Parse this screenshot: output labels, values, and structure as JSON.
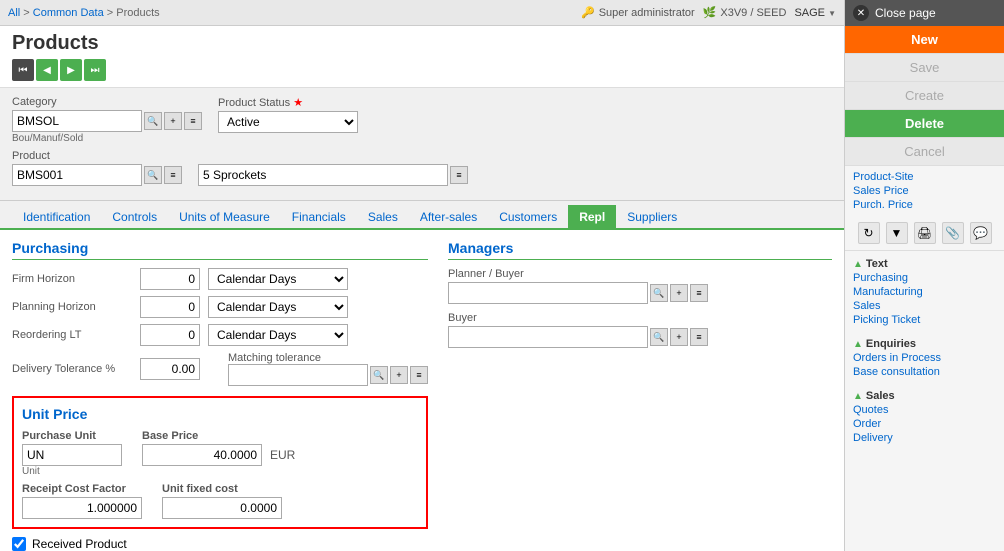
{
  "breadcrumb": {
    "all": "All",
    "common_data": "Common Data",
    "products": "Products"
  },
  "user_info": {
    "admin": "Super administrator",
    "version": "X3V9 / SEED",
    "sage": "SAGE"
  },
  "page": {
    "title": "Products"
  },
  "nav": {
    "first": "⏮",
    "prev": "◀",
    "next": "▶",
    "last": "⏭"
  },
  "form": {
    "category_label": "Category",
    "category_value": "BMSOL",
    "category_sub": "Bou/Manuf/Sold",
    "product_status_label": "Product Status",
    "product_status_required": true,
    "product_status_value": "Active",
    "product_label": "Product",
    "product_value": "BMS001",
    "product_name": "5 Sprockets"
  },
  "tabs": [
    {
      "label": "Identification",
      "active": false
    },
    {
      "label": "Controls",
      "active": false
    },
    {
      "label": "Units of Measure",
      "active": false
    },
    {
      "label": "Financials",
      "active": false
    },
    {
      "label": "Sales",
      "active": false
    },
    {
      "label": "After-sales",
      "active": false
    },
    {
      "label": "Customers",
      "active": false
    },
    {
      "label": "Repl",
      "active": true
    },
    {
      "label": "Suppliers",
      "active": false
    }
  ],
  "purchasing": {
    "title": "Purchasing",
    "firm_horizon_label": "Firm Horizon",
    "firm_horizon_value": "0",
    "firm_horizon_unit": "Calendar Days",
    "planning_horizon_label": "Planning Horizon",
    "planning_horizon_value": "0",
    "planning_horizon_unit": "Calendar Days",
    "reordering_lt_label": "Reordering LT",
    "reordering_lt_value": "0",
    "reordering_lt_unit": "Calendar Days",
    "delivery_tolerance_label": "Delivery Tolerance %",
    "delivery_tolerance_value": "0.00",
    "matching_tolerance_label": "Matching tolerance",
    "received_product_label": "Received Product"
  },
  "managers": {
    "title": "Managers",
    "planner_buyer_label": "Planner / Buyer",
    "buyer_label": "Buyer"
  },
  "unit_price": {
    "title": "Unit Price",
    "purchase_unit_label": "Purchase Unit",
    "purchase_unit_value": "UN",
    "purchase_unit_sub": "Unit",
    "base_price_label": "Base Price",
    "base_price_value": "40.0000",
    "currency": "EUR",
    "receipt_cost_label": "Receipt Cost Factor",
    "receipt_cost_value": "1.000000",
    "unit_fixed_cost_label": "Unit fixed cost",
    "unit_fixed_cost_value": "0.0000"
  },
  "sidebar": {
    "close_label": "Close page",
    "new_label": "New",
    "save_label": "Save",
    "create_label": "Create",
    "delete_label": "Delete",
    "cancel_label": "Cancel",
    "product_site_label": "Product-Site",
    "sales_price_label": "Sales Price",
    "purch_price_label": "Purch. Price",
    "text_section": "Text",
    "text_links": [
      "Purchasing",
      "Manufacturing",
      "Sales",
      "Picking Ticket"
    ],
    "enquiries_section": "Enquiries",
    "enquiries_links": [
      "Orders in Process",
      "Base consultation"
    ],
    "sales_section": "Sales",
    "sales_links": [
      "Quotes",
      "Order",
      "Delivery"
    ]
  }
}
